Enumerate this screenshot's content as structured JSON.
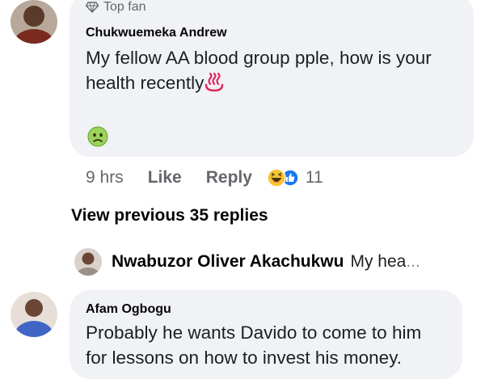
{
  "comment1": {
    "badge": "Top fan",
    "author": "Chukwuemeka Andrew",
    "line1": "My fellow AA blood group pple, how is your",
    "line2": "health recently",
    "time": "9 hrs",
    "like_label": "Like",
    "reply_label": "Reply",
    "reaction_count": "11",
    "icons": [
      "avatar",
      "diamond-badge-icon",
      "hot-springs-emoji",
      "sick-face-emoji",
      "haha-reaction-icon",
      "like-reaction-icon"
    ]
  },
  "view_previous": "View previous 35 replies",
  "reply_preview": {
    "author": "Nwabuzor Oliver Akachukwu",
    "text": "My hea",
    "ellipsis": "..."
  },
  "comment2": {
    "author": "Afam Ogbogu",
    "line1": "Probably he wants Davido to come to him",
    "line2": "for lessons on how to invest his money."
  },
  "colors": {
    "bubble": "#f0f2f5",
    "secondary_text": "#65676b",
    "primary_text": "#050505"
  }
}
